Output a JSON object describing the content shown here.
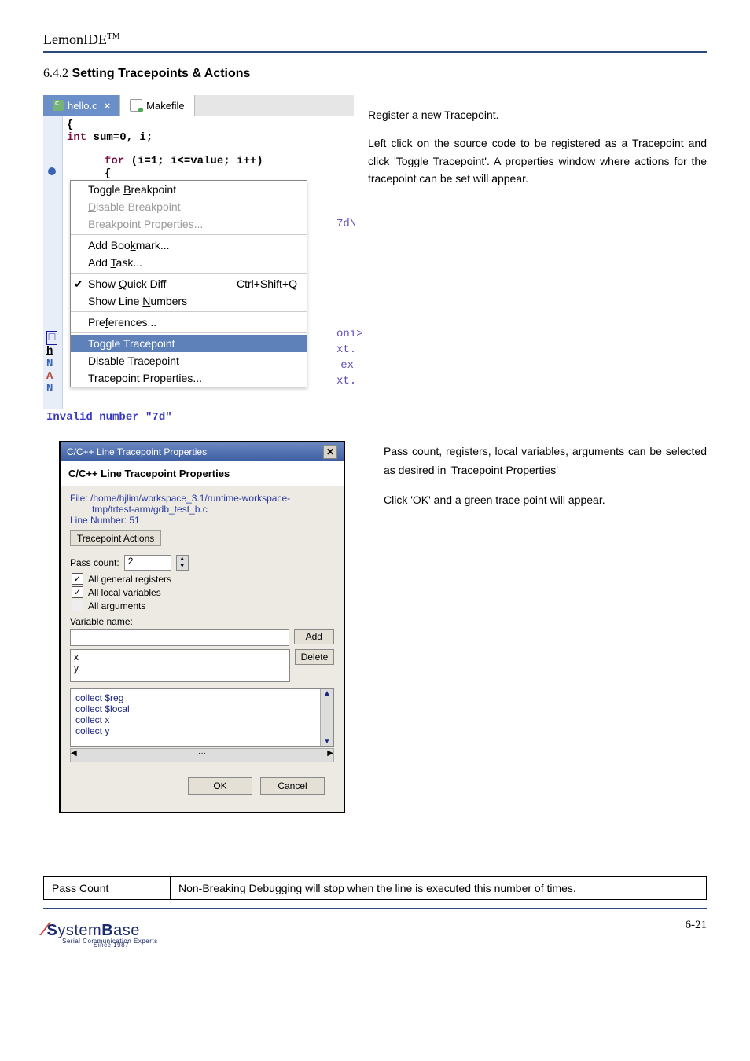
{
  "doc_title": "LemonIDE",
  "doc_title_suffix": "TM",
  "section_number": "6.4.2",
  "section_title": "Setting Tracepoints & Actions",
  "tabs": {
    "active": "hello.c",
    "other": "Makefile"
  },
  "code": {
    "l1": "{",
    "l2a": "int",
    "l2b": " sum=0, i;",
    "l3a": "for",
    "l3b": " (i=1; i<=value; i++)",
    "l4": "{"
  },
  "ctx": {
    "toggle_bp": "Toggle Breakpoint",
    "disable_bp": "Disable Breakpoint",
    "bp_props": "Breakpoint Properties...",
    "add_book": "Add Bookmark...",
    "add_task": "Add Task...",
    "quick_diff": "Show Quick Diff",
    "quick_diff_sc": "Ctrl+Shift+Q",
    "line_nums": "Show Line Numbers",
    "prefs": "Preferences...",
    "toggle_tp": "Toggle Tracepoint",
    "disable_tp": "Disable Tracepoint",
    "tp_props": "Tracepoint Properties..."
  },
  "right_strip": {
    "a": "7d\\",
    "b": "oni>",
    "c": "xt.",
    "d": "ex",
    "e": "xt."
  },
  "left_markers": {
    "m1": "h",
    "m2": "N",
    "m3": "A",
    "m4": "N"
  },
  "invalid": "Invalid number \"7d\"",
  "para1": {
    "p1": "Register a new Tracepoint.",
    "p2": "Left click on the source code to be registered as a Tracepoint and click 'Toggle Tracepoint'. A properties window where actions for the tracepoint can be set will appear."
  },
  "dlg": {
    "title": "C/C++ Line Tracepoint Properties",
    "header": "C/C++ Line Tracepoint Properties",
    "file_lbl": "File: ",
    "file_val1": "/home/hjlim/workspace_3.1/runtime-workspace-",
    "file_val2": "tmp/trtest-arm/gdb_test_b.c",
    "line_num": "Line Number:  51",
    "tab_actions": "Tracepoint Actions",
    "pass_lbl": "Pass count:",
    "pass_val": "2",
    "cb_reg": "All general registers",
    "cb_loc": "All local variables",
    "cb_arg": "All arguments",
    "var_lbl": "Variable name:",
    "btn_add": "Add",
    "btn_del": "Delete",
    "lx": "x",
    "ly": "y",
    "c1": "collect $reg",
    "c2": "collect $local",
    "c3": "collect x",
    "c4": "collect y",
    "ok": "OK",
    "cancel": "Cancel"
  },
  "para2": {
    "p1": "Pass count, registers, local variables, arguments can be selected as desired in 'Tracepoint Properties'",
    "p2": "Click 'OK' and a green trace point will appear."
  },
  "table": {
    "h": "Pass Count",
    "d": "Non-Breaking Debugging will stop when the line is executed this number of times."
  },
  "logo": {
    "name": "SystemBase",
    "tag1": "Serial Communication Experts",
    "tag2": "Since 1987"
  },
  "page_no": "6-21"
}
